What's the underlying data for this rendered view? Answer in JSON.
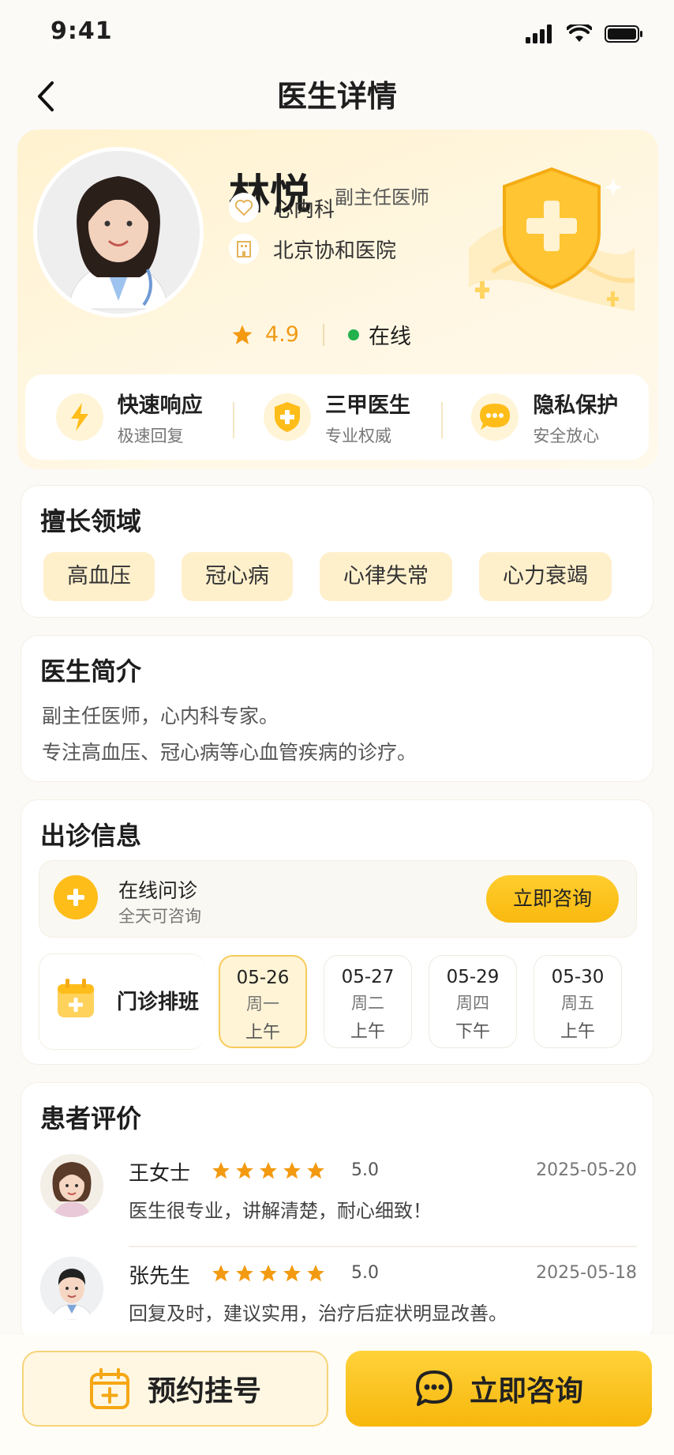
{
  "status": {
    "time": "9:41"
  },
  "nav": {
    "title": "医生详情"
  },
  "doctor": {
    "name": "林悦",
    "title": "副主任医师",
    "department": "心内科",
    "hospital": "北京协和医院",
    "rating": "4.9",
    "status": "在线"
  },
  "features": [
    {
      "title": "快速响应",
      "sub": "极速回复",
      "icon": "lightning-icon"
    },
    {
      "title": "三甲医生",
      "sub": "专业权威",
      "icon": "shield-plus-icon"
    },
    {
      "title": "隐私保护",
      "sub": "安全放心",
      "icon": "chat-bubble-icon"
    }
  ],
  "specialty": {
    "title": "擅长领域",
    "tags": [
      "高血压",
      "冠心病",
      "心律失常",
      "心力衰竭"
    ]
  },
  "intro": {
    "title": "医生简介",
    "lines": [
      "副主任医师，心内科专家。",
      "专注高血压、冠心病等心血管疾病的诊疗。"
    ]
  },
  "clinic": {
    "title": "出诊信息",
    "online": {
      "title": "在线问诊",
      "sub": "全天可咨询",
      "button": "立即咨询"
    },
    "schedule_label": "门诊排班",
    "schedule": [
      {
        "date": "05-26",
        "weekday": "周一",
        "slot": "上午",
        "selected": true
      },
      {
        "date": "05-27",
        "weekday": "周二",
        "slot": "上午",
        "selected": false
      },
      {
        "date": "05-29",
        "weekday": "周四",
        "slot": "下午",
        "selected": false
      },
      {
        "date": "05-30",
        "weekday": "周五",
        "slot": "上午",
        "selected": false
      }
    ]
  },
  "reviews": {
    "title": "患者评价",
    "items": [
      {
        "name": "王女士",
        "score": "5.0",
        "stars": 5,
        "date": "2025-05-20",
        "text": "医生很专业，讲解清楚，耐心细致！"
      },
      {
        "name": "张先生",
        "score": "5.0",
        "stars": 5,
        "date": "2025-05-18",
        "text": "回复及时，建议实用，治疗后症状明显改善。"
      }
    ]
  },
  "bottom": {
    "book_label": "预约挂号",
    "consult_label": "立即咨询"
  },
  "colors": {
    "accent": "#f9b90f",
    "accent_light": "#fff4d6",
    "star": "#f39a12",
    "online": "#22b14c"
  }
}
